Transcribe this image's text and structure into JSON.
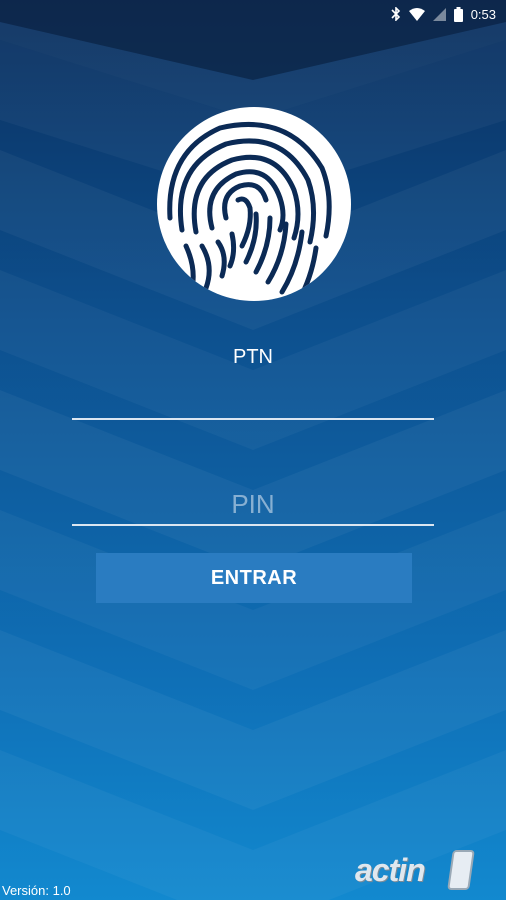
{
  "status_bar": {
    "time": "0:53",
    "icons": [
      "bluetooth-icon",
      "wifi-icon",
      "signal-icon",
      "battery-icon"
    ]
  },
  "login": {
    "ptn_label": "PTN",
    "ptn_value": "",
    "pin_placeholder": "PIN",
    "pin_value": "",
    "enter_label": "ENTRAR"
  },
  "footer": {
    "version": "Versión: 1.0",
    "brand": "actin"
  },
  "colors": {
    "top": "#0b2f5e",
    "bottom": "#1289cf",
    "button": "#2a7cc1"
  }
}
